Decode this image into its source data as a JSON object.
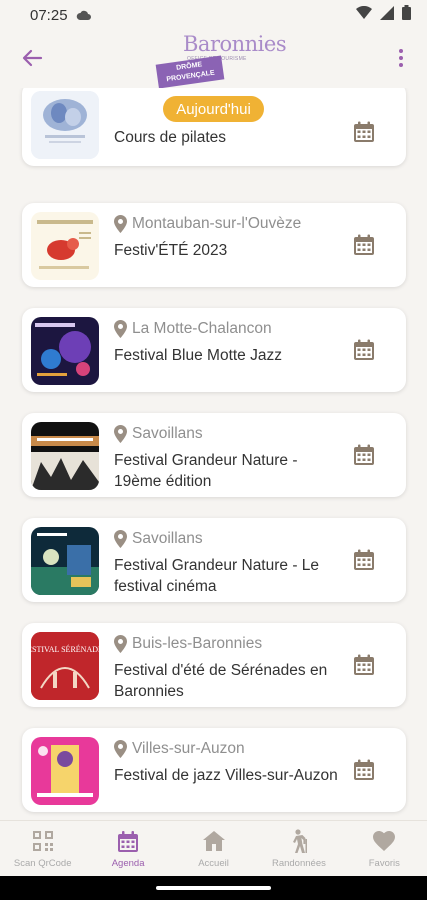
{
  "status_bar": {
    "time": "07:25"
  },
  "header": {
    "logo_text": "Baronnies",
    "logo_sub": "OFFICE DE TOURISME",
    "logo_badge": "DRÔME PROVENÇALE"
  },
  "today_button": "Aujourd'hui",
  "events": [
    {
      "place": "",
      "title": "Cours de pilates"
    },
    {
      "place": "Montauban-sur-l'Ouvèze",
      "title": "Festiv'ÉTÉ 2023"
    },
    {
      "place": "La Motte-Chalancon",
      "title": "Festival Blue Motte Jazz"
    },
    {
      "place": "Savoillans",
      "title": "Festival Grandeur Nature - 19ème édition"
    },
    {
      "place": "Savoillans",
      "title": "Festival Grandeur Nature - Le festival cinéma"
    },
    {
      "place": "Buis-les-Baronnies",
      "title": "Festival d'été de Sérénades en Baronnies"
    },
    {
      "place": "Villes-sur-Auzon",
      "title": "Festival de jazz Villes-sur-Auzon"
    }
  ],
  "thumb_texts": {
    "serenades": "FESTIVAL SÉRÉNADES"
  },
  "nav": [
    {
      "label": "Scan QrCode",
      "icon": "qrcode-icon"
    },
    {
      "label": "Agenda",
      "icon": "calendar-icon",
      "active": true
    },
    {
      "label": "Accueil",
      "icon": "home-icon"
    },
    {
      "label": "Randonnées",
      "icon": "hiker-icon"
    },
    {
      "label": "Favoris",
      "icon": "heart-icon"
    }
  ],
  "colors": {
    "accent": "#9b5fae",
    "pill": "#f0b234",
    "calendar": "#8a7b6b"
  }
}
